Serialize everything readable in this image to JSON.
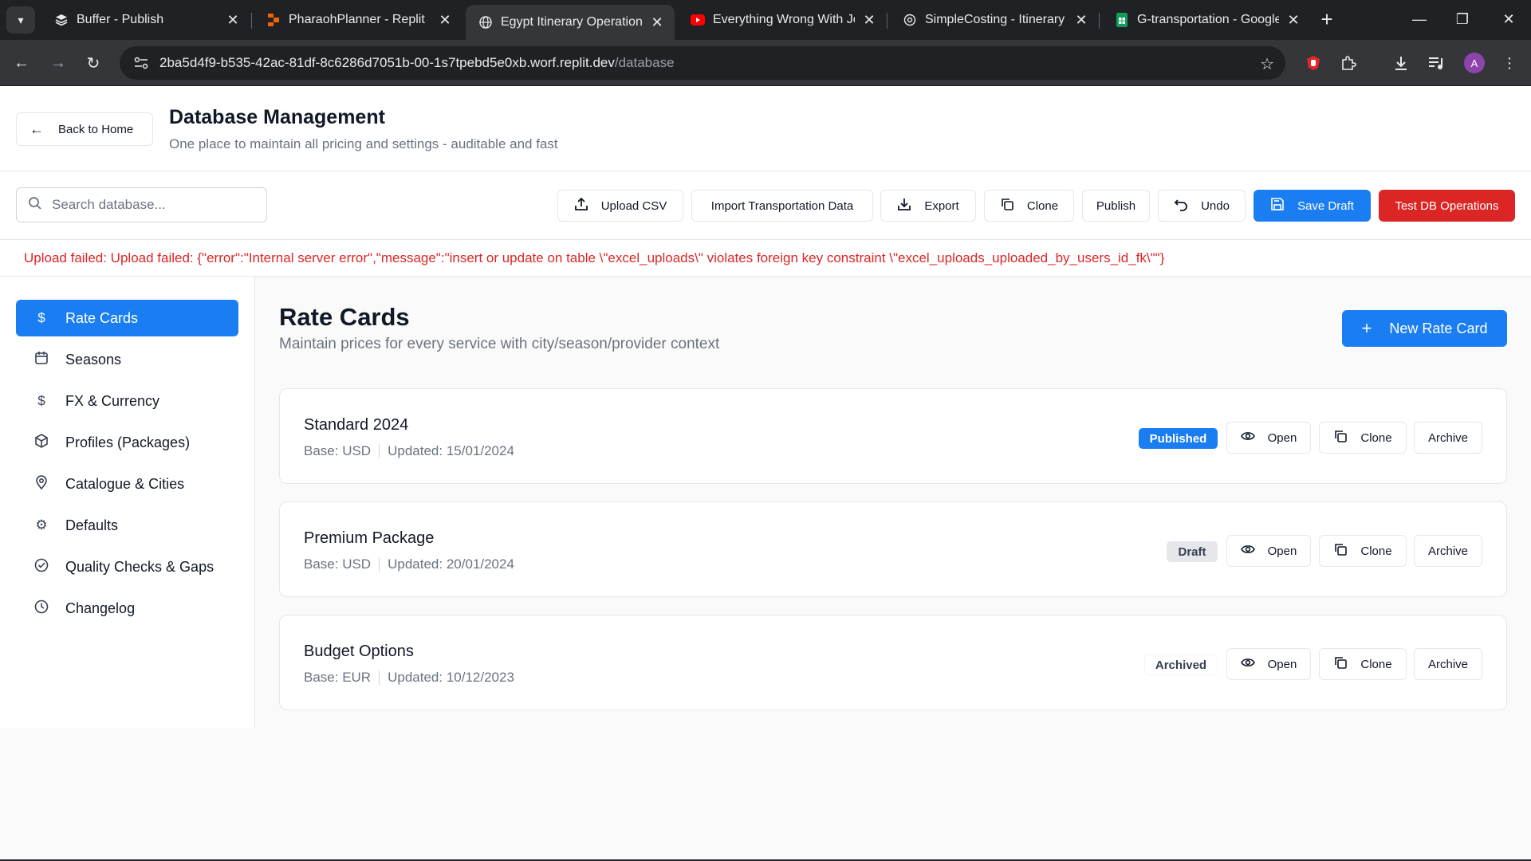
{
  "browser": {
    "tabs": [
      {
        "title": "Buffer - Publish",
        "icon": "buffer-icon"
      },
      {
        "title": "PharaohPlanner - Replit",
        "icon": "replit-icon"
      },
      {
        "title": "Egypt Itinerary Operations",
        "icon": "globe-icon",
        "active": true
      },
      {
        "title": "Everything Wrong With Jol",
        "icon": "youtube-icon"
      },
      {
        "title": "SimpleCosting - Itinerary s",
        "icon": "openai-icon"
      },
      {
        "title": "G-transportation - Google",
        "icon": "sheets-icon"
      }
    ],
    "url_host": "2ba5d4f9-b535-42ac-81df-8c6286d7051b-00-1s7tpebd5e0xb.worf.replit.dev",
    "url_path": "/database",
    "avatar_initial": "A"
  },
  "header": {
    "back_label": "Back to Home",
    "title": "Database Management",
    "subtitle": "One place to maintain all pricing and settings - auditable and fast"
  },
  "toolbar": {
    "search_placeholder": "Search database...",
    "upload_csv": "Upload CSV",
    "import_transport": "Import Transportation Data",
    "export": "Export",
    "clone": "Clone",
    "publish": "Publish",
    "undo": "Undo",
    "save_draft": "Save Draft",
    "test_db": "Test DB Operations"
  },
  "error_message": "Upload failed: Upload failed: {\"error\":\"Internal server error\",\"message\":\"insert or update on table \\\"excel_uploads\\\" violates foreign key constraint \\\"excel_uploads_uploaded_by_users_id_fk\\\"\"}",
  "sidebar": {
    "items": [
      {
        "label": "Rate Cards",
        "icon": "dollar-icon",
        "active": true
      },
      {
        "label": "Seasons",
        "icon": "calendar-icon"
      },
      {
        "label": "FX & Currency",
        "icon": "dollar-icon"
      },
      {
        "label": "Profiles (Packages)",
        "icon": "package-icon"
      },
      {
        "label": "Catalogue & Cities",
        "icon": "map-pin-icon"
      },
      {
        "label": "Defaults",
        "icon": "gear-icon"
      },
      {
        "label": "Quality Checks & Gaps",
        "icon": "check-circle-icon"
      },
      {
        "label": "Changelog",
        "icon": "clock-icon"
      }
    ]
  },
  "main": {
    "title": "Rate Cards",
    "subtitle": "Maintain prices for every service with city/season/provider context",
    "new_button": "New Rate Card",
    "open_label": "Open",
    "clone_label": "Clone",
    "archive_label": "Archive",
    "cards": [
      {
        "name": "Standard 2024",
        "base": "Base: USD",
        "updated": "Updated: 15/01/2024",
        "status": "Published"
      },
      {
        "name": "Premium Package",
        "base": "Base: USD",
        "updated": "Updated: 20/01/2024",
        "status": "Draft"
      },
      {
        "name": "Budget Options",
        "base": "Base: EUR",
        "updated": "Updated: 10/12/2023",
        "status": "Archived"
      }
    ]
  },
  "colors": {
    "primary": "#1a7ef2",
    "danger": "#dc2626",
    "chrome_dark": "#202124"
  }
}
